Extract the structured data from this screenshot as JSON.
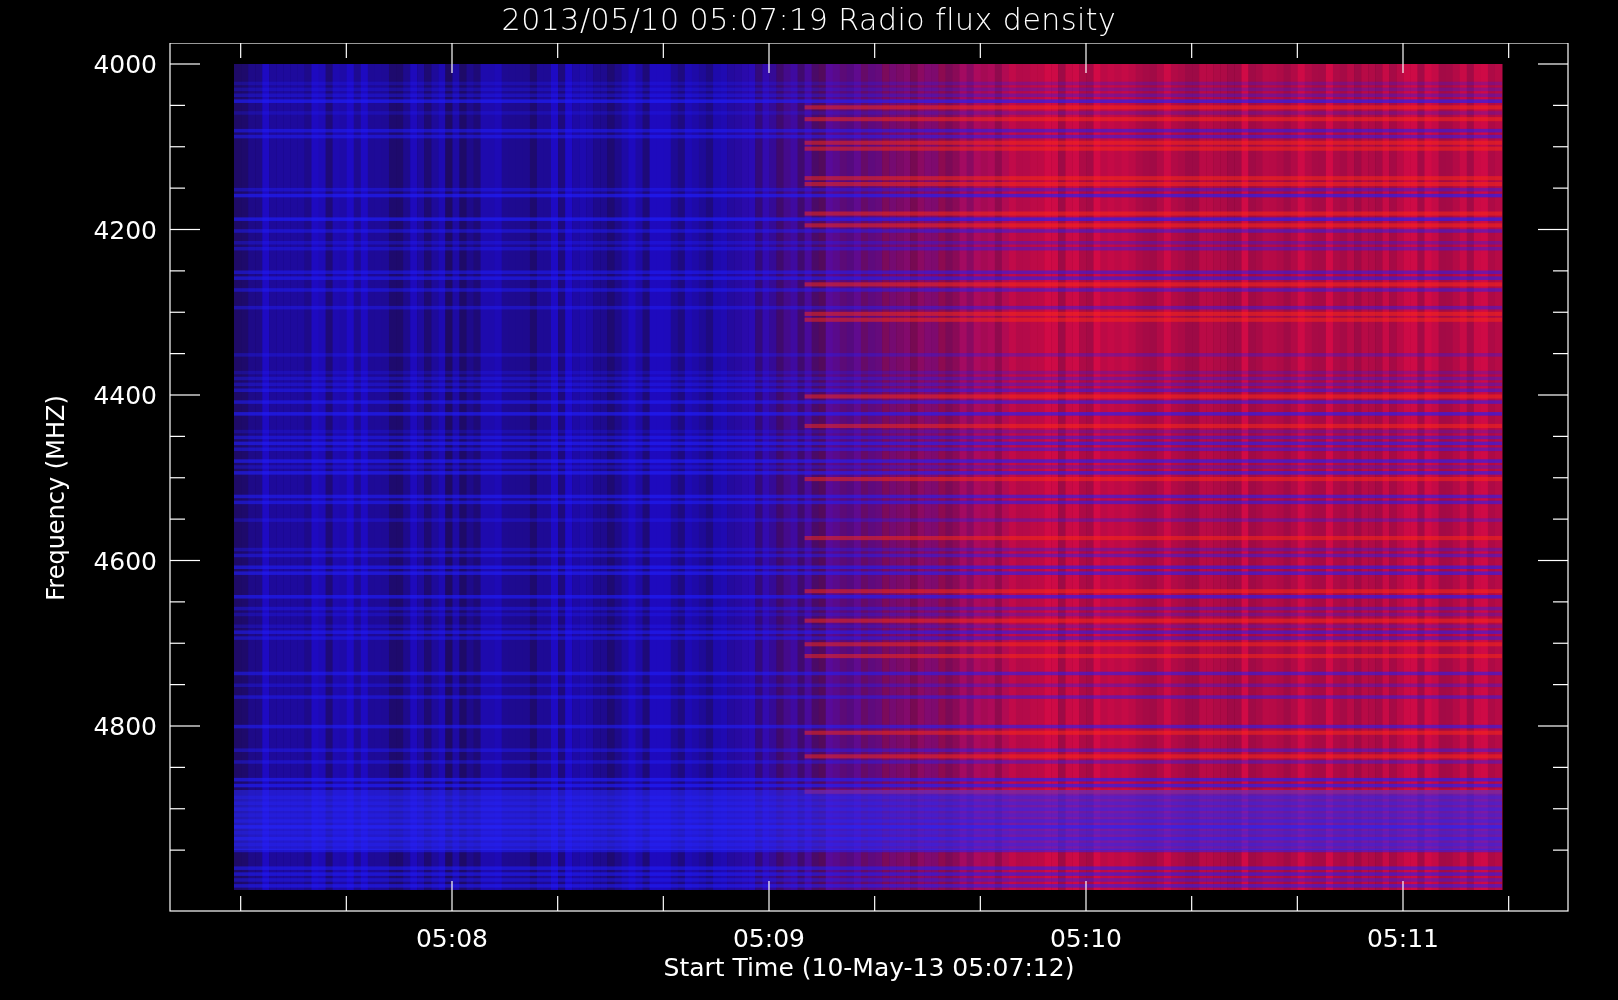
{
  "title": "2013/05/10 05:07:19 Radio flux density",
  "ylabel": "Frequency (MHZ)",
  "xlabel": "Start Time (10-May-13 05:07:12)",
  "yticks": [
    "4000",
    "4200",
    "4400",
    "4600",
    "4800"
  ],
  "xticks": [
    "05:08",
    "05:09",
    "05:10",
    "05:11"
  ]
}
